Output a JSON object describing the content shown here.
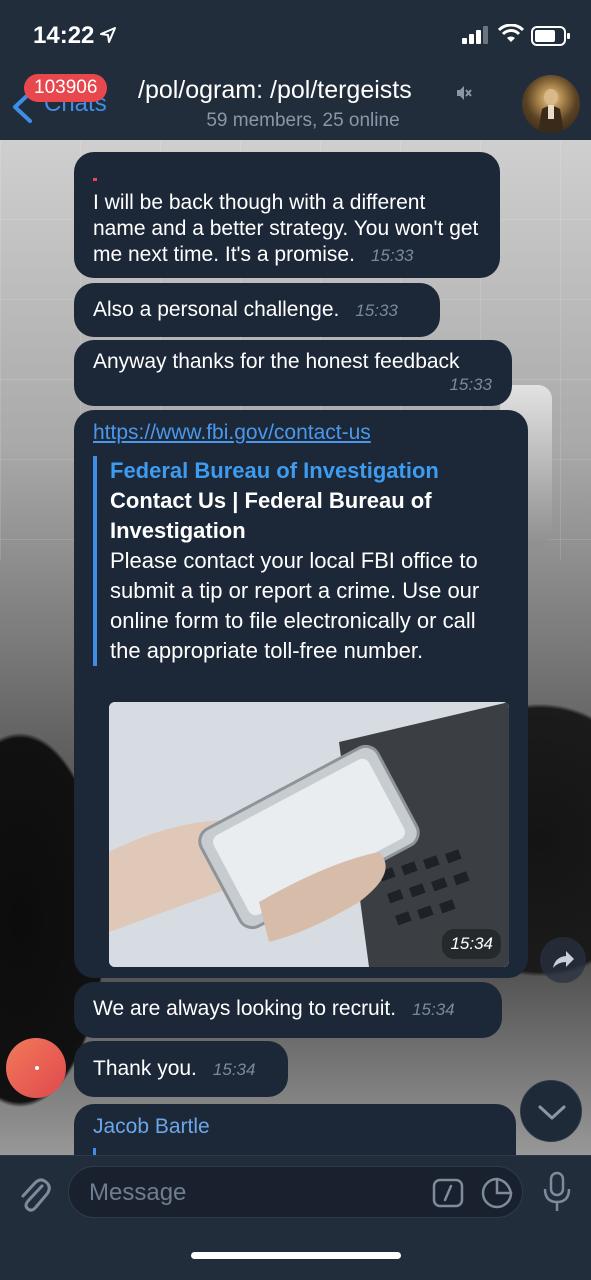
{
  "status_bar": {
    "time": "14:22"
  },
  "nav": {
    "back_label": "Chats",
    "unread_badge": "103906",
    "title": "/pol/ogram: /pol/tergeists",
    "subtitle": "59 members, 25 online"
  },
  "messages": [
    {
      "text": "I will be back though with a different name and a better strategy. You won't get me next time. It's a promise.",
      "time": "15:33"
    },
    {
      "text": "Also a personal challenge.",
      "time": "15:33"
    },
    {
      "text": "Anyway thanks for the honest feedback",
      "time": "15:33"
    },
    {
      "link": "https://www.fbi.gov/contact-us",
      "preview_site": "Federal Bureau of Investigation",
      "preview_title": "Contact Us | Federal Bureau of Investigation",
      "preview_desc": "Please contact your local FBI office to submit a tip or report a crime. Use our online form to file electronically or call the appropriate toll-free number.",
      "time": "15:34"
    },
    {
      "text": "We are always looking to recruit.",
      "time": "15:34"
    },
    {
      "text": "Thank you.",
      "time": "15:34"
    },
    {
      "sender": "Jacob Bartle"
    }
  ],
  "input": {
    "placeholder": "Message"
  },
  "colors": {
    "accent": "#3e8ee8",
    "badge": "#e8484d",
    "bubble": "#1c2737",
    "header": "#222d3b"
  }
}
